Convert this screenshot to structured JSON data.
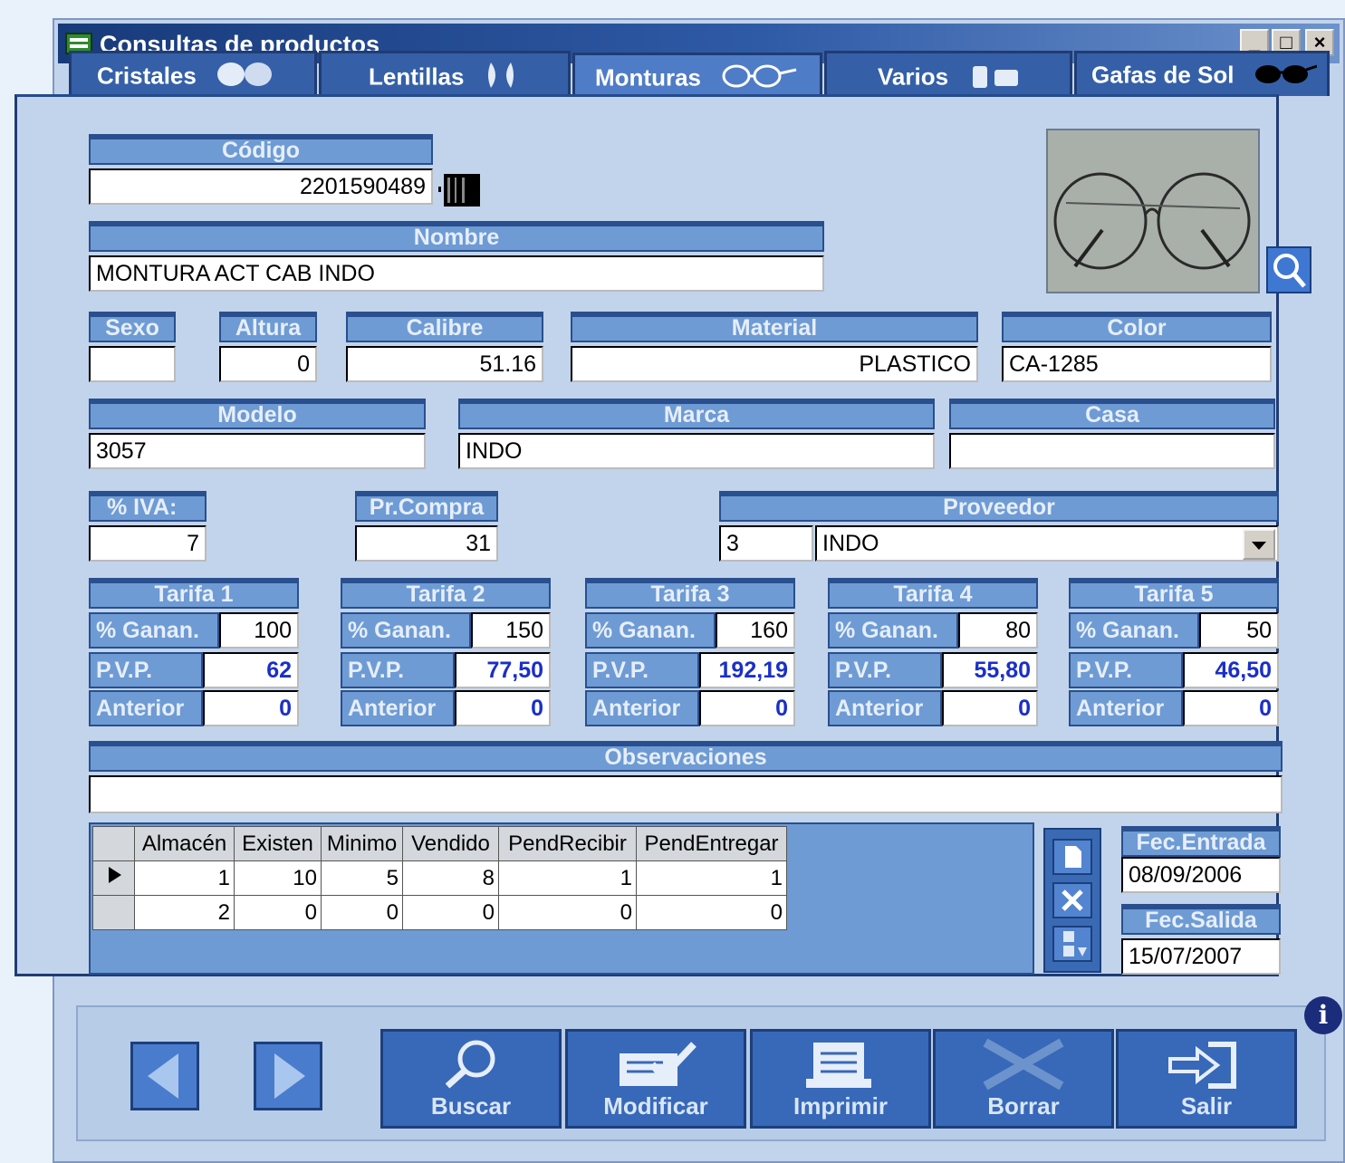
{
  "window": {
    "title": "Consultas de productos",
    "minimize": "_",
    "maximize": "□",
    "close": "×"
  },
  "tabs": [
    "Cristales",
    "Lentillas",
    "Monturas",
    "Varios",
    "Gafas de Sol"
  ],
  "form": {
    "codigo": {
      "label": "Código",
      "value": "2201590489"
    },
    "nombre": {
      "label": "Nombre",
      "value": "MONTURA ACT CAB INDO"
    },
    "sexo": {
      "label": "Sexo",
      "value": ""
    },
    "altura": {
      "label": "Altura",
      "value": "0"
    },
    "calibre": {
      "label": "Calibre",
      "value": "51.16"
    },
    "material": {
      "label": "Material",
      "value": "PLASTICO"
    },
    "color": {
      "label": "Color",
      "value": "CA-1285"
    },
    "modelo": {
      "label": "Modelo",
      "value": "3057"
    },
    "marca": {
      "label": "Marca",
      "value": "INDO"
    },
    "casa": {
      "label": "Casa",
      "value": ""
    },
    "iva": {
      "label": "% IVA:",
      "value": "7"
    },
    "prcompra": {
      "label": "Pr.Compra",
      "value": "31"
    },
    "proveedor": {
      "label": "Proveedor",
      "code": "3",
      "name": "INDO"
    }
  },
  "tarifas": [
    {
      "title": "Tarifa 1",
      "ganan": "100",
      "pvp": "62",
      "anterior": "0"
    },
    {
      "title": "Tarifa 2",
      "ganan": "150",
      "pvp": "77,50",
      "anterior": "0"
    },
    {
      "title": "Tarifa 3",
      "ganan": "160",
      "pvp": "192,19",
      "anterior": "0"
    },
    {
      "title": "Tarifa 4",
      "ganan": "80",
      "pvp": "55,80",
      "anterior": "0"
    },
    {
      "title": "Tarifa 5",
      "ganan": "50",
      "pvp": "46,50",
      "anterior": "0"
    }
  ],
  "tarifa_labels": {
    "ganan": "% Ganan.",
    "pvp": "P.V.P.",
    "anterior": "Anterior"
  },
  "observaciones": {
    "label": "Observaciones",
    "value": ""
  },
  "stock": {
    "columns": [
      "Almacén",
      "Existen",
      "Minimo",
      "Vendido",
      "PendRecibir",
      "PendEntregar"
    ],
    "rows": [
      [
        "1",
        "10",
        "5",
        "8",
        "1",
        "1"
      ],
      [
        "2",
        "0",
        "0",
        "0",
        "0",
        "0"
      ]
    ]
  },
  "fechas": {
    "entrada": {
      "label": "Fec.Entrada",
      "value": "08/09/2006"
    },
    "salida": {
      "label": "Fec.Salida",
      "value": "15/07/2007"
    }
  },
  "actions": [
    "Buscar",
    "Modificar",
    "Imprimir",
    "Borrar",
    "Salir"
  ],
  "icons": [
    "window-app-icon",
    "cristales-icon",
    "lentillas-icon",
    "monturas-icon",
    "varios-icon",
    "gafas-sol-icon",
    "barcode-icon",
    "magnifier-icon",
    "dropdown-arrow-icon",
    "row-pointer-icon",
    "new-doc-icon",
    "delete-x-icon",
    "sort-az-icon",
    "prev-arrow-icon",
    "next-arrow-icon",
    "search-icon",
    "edit-icon",
    "print-icon",
    "delete-icon",
    "exit-icon",
    "info-icon"
  ],
  "colors": {
    "title_bar": "#173a7a",
    "panel": "#c2d4ec",
    "label_blue": "#6e9bd3",
    "price_text": "#1a2fc8"
  }
}
